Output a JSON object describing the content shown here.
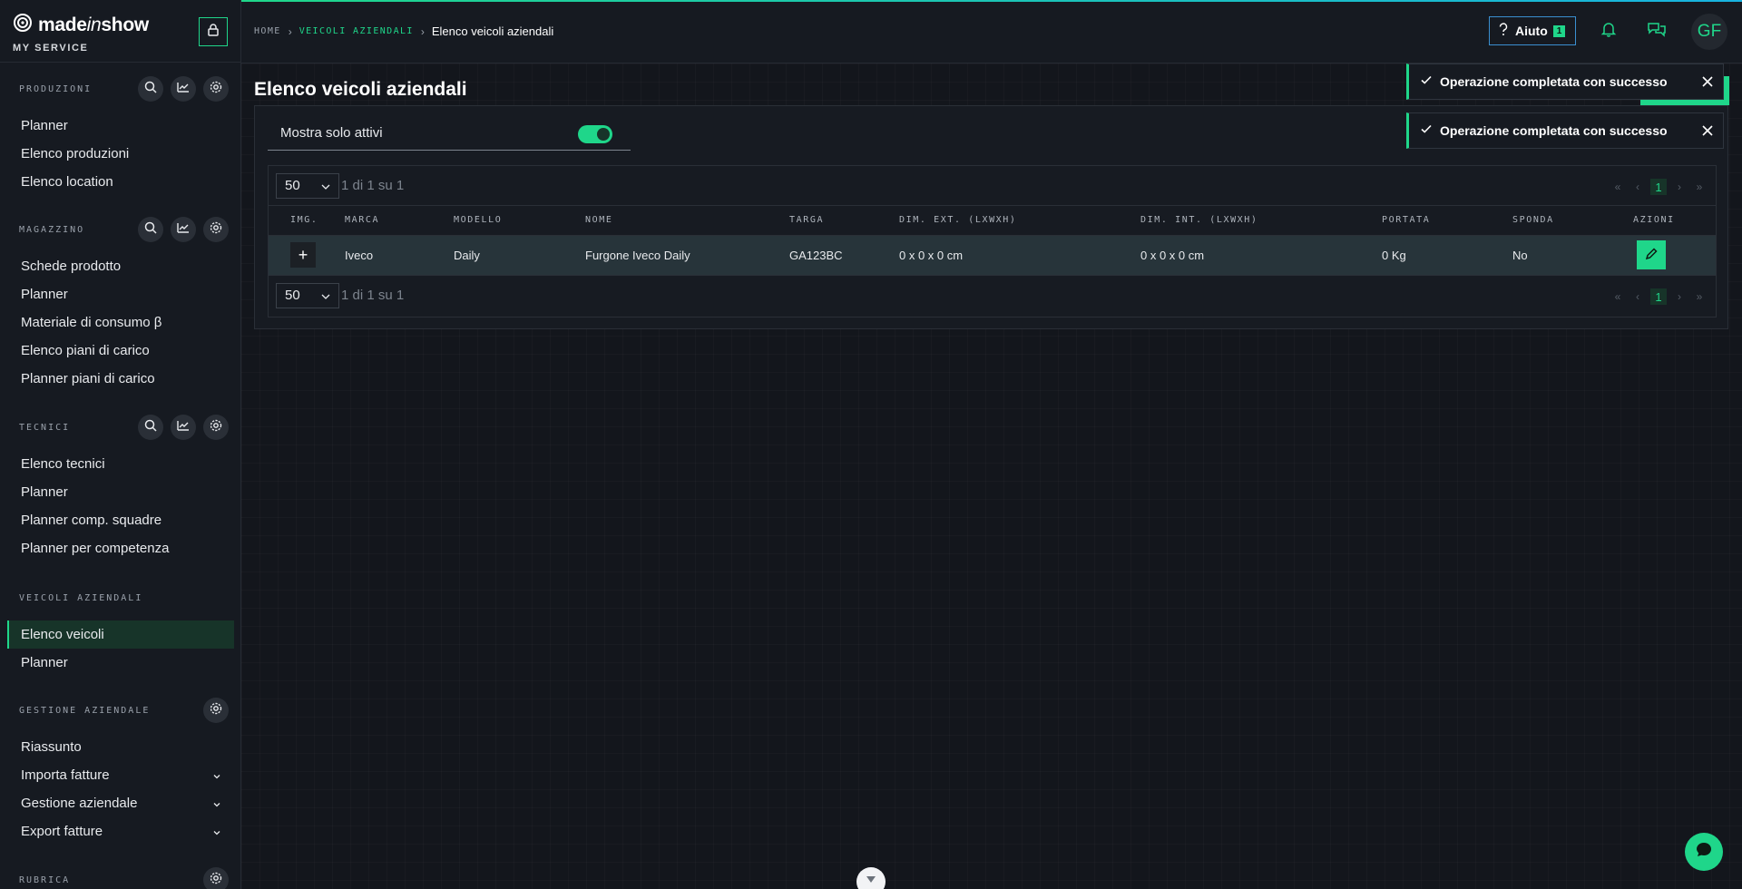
{
  "brand": {
    "name_prefix": "made",
    "name_italic": "in",
    "name_suffix": "show",
    "subtitle": "MY SERVICE"
  },
  "colors": {
    "accent": "#1fd68a",
    "background": "#13161c",
    "sidebar": "#161a21",
    "row_highlight": "#27343a",
    "help_border": "#3a8fd0"
  },
  "breadcrumb": {
    "home": "HOME",
    "link": "VEICOLI AZIENDALI",
    "current": "Elenco veicoli aziendali"
  },
  "header": {
    "help_label": "Aiuto",
    "help_badge": "1",
    "avatar_initials": "GF"
  },
  "sidebar": {
    "sections": [
      {
        "title": "PRODUZIONI",
        "icons": [
          "search-icon",
          "chart-icon",
          "gear-icon"
        ],
        "items": [
          {
            "label": "Planner"
          },
          {
            "label": "Elenco produzioni"
          },
          {
            "label": "Elenco location"
          }
        ]
      },
      {
        "title": "MAGAZZINO",
        "icons": [
          "search-icon",
          "chart-icon",
          "gear-icon"
        ],
        "items": [
          {
            "label": "Schede prodotto"
          },
          {
            "label": "Planner"
          },
          {
            "label": "Materiale di consumo β"
          },
          {
            "label": "Elenco piani di carico"
          },
          {
            "label": "Planner piani di carico"
          }
        ]
      },
      {
        "title": "TECNICI",
        "icons": [
          "search-icon",
          "chart-icon",
          "gear-icon"
        ],
        "items": [
          {
            "label": "Elenco tecnici"
          },
          {
            "label": "Planner"
          },
          {
            "label": "Planner comp. squadre"
          },
          {
            "label": "Planner per competenza"
          }
        ]
      },
      {
        "title": "VEICOLI AZIENDALI",
        "icons": [],
        "items": [
          {
            "label": "Elenco veicoli",
            "active": true
          },
          {
            "label": "Planner"
          }
        ]
      },
      {
        "title": "GESTIONE AZIENDALE",
        "icons": [
          "gear-icon"
        ],
        "items": [
          {
            "label": "Riassunto"
          },
          {
            "label": "Importa fatture",
            "expandable": true
          },
          {
            "label": "Gestione aziendale",
            "expandable": true
          },
          {
            "label": "Export fatture",
            "expandable": true
          }
        ]
      },
      {
        "title": "RUBRICA",
        "icons": [
          "gear-icon"
        ],
        "items": []
      }
    ]
  },
  "main": {
    "title": "Elenco veicoli aziendali",
    "filter": {
      "label": "Mostra solo attivi",
      "active": true
    },
    "pagination": {
      "per_page": "50",
      "info": "1 di 1 su 1",
      "current_page": "1"
    },
    "table": {
      "columns": [
        "IMG.",
        "MARCA",
        "MODELLO",
        "NOME",
        "TARGA",
        "DIM. EXT. (LXWXH)",
        "DIM. INT. (LXWXH)",
        "PORTATA",
        "SPONDA",
        "AZIONI"
      ],
      "rows": [
        {
          "img": "+",
          "marca": "Iveco",
          "modello": "Daily",
          "nome": "Furgone Iveco Daily",
          "targa": "GA123BC",
          "dim_ext": "0 x 0 x 0 cm",
          "dim_int": "0 x 0 x 0 cm",
          "portata": "0 Kg",
          "sponda": "No"
        }
      ]
    }
  },
  "toasts": [
    {
      "message": "Operazione completata con successo"
    },
    {
      "message": "Operazione completata con successo"
    }
  ]
}
